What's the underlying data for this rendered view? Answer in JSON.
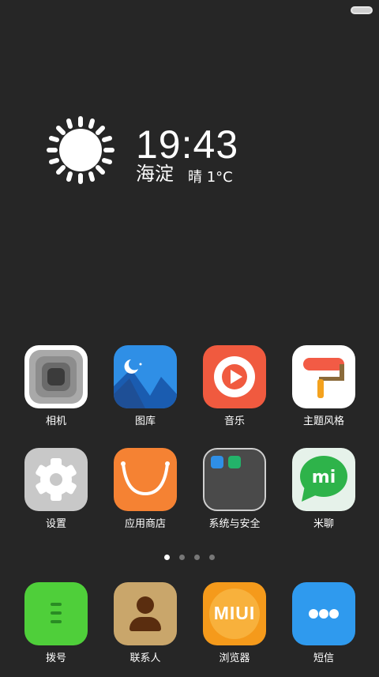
{
  "status_bar": {
    "battery_icon": "battery-icon"
  },
  "widget": {
    "weather_icon": "sun-icon",
    "time": "19:43",
    "location": "海淀",
    "condition": "晴 1°C"
  },
  "apps_row1": [
    {
      "label": "相机",
      "icon": "camera-icon"
    },
    {
      "label": "图库",
      "icon": "gallery-icon"
    },
    {
      "label": "音乐",
      "icon": "music-icon"
    },
    {
      "label": "主题风格",
      "icon": "theme-icon"
    }
  ],
  "apps_row2": [
    {
      "label": "设置",
      "icon": "gear-icon"
    },
    {
      "label": "应用商店",
      "icon": "store-icon"
    },
    {
      "label": "系统与安全",
      "icon": "folder-icon"
    },
    {
      "label": "米聊",
      "icon": "mi-chat-icon"
    }
  ],
  "dock": [
    {
      "label": "拨号",
      "icon": "dialer-icon"
    },
    {
      "label": "联系人",
      "icon": "contacts-icon"
    },
    {
      "label": "浏览器",
      "icon": "browser-icon",
      "text": "MIUI"
    },
    {
      "label": "短信",
      "icon": "sms-icon"
    }
  ],
  "pager": {
    "count": 4,
    "active": 0
  },
  "colors": {
    "background": "#262626"
  }
}
